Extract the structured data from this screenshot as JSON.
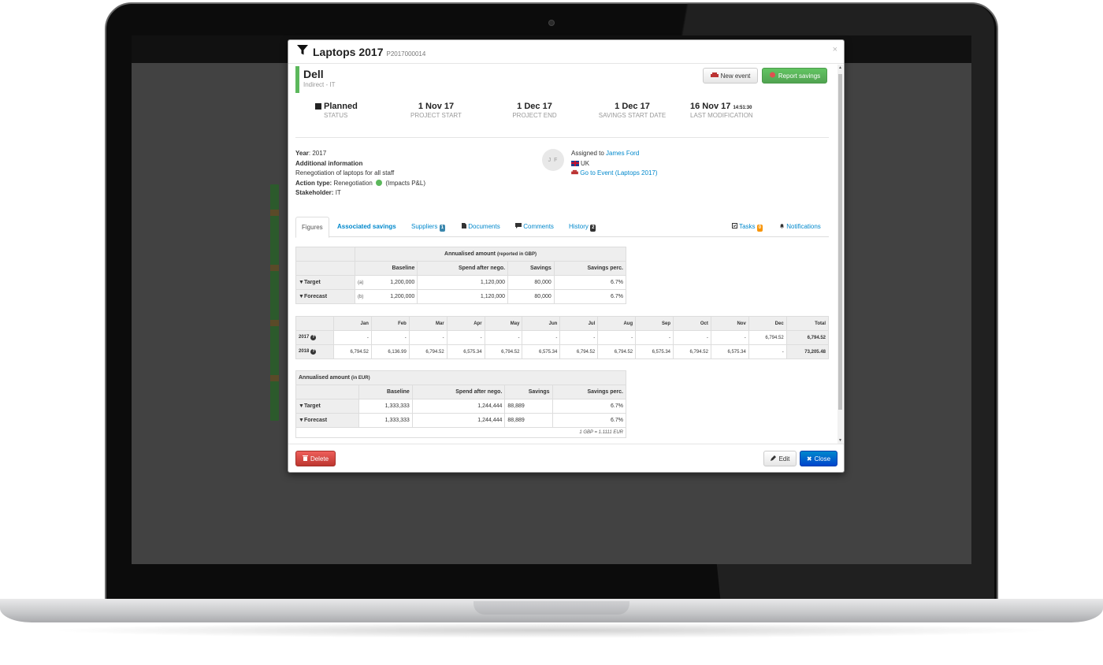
{
  "modal": {
    "title": "Laptops 2017",
    "code": "P2017000014",
    "close_x": "×",
    "supplier": {
      "name": "Dell",
      "category": "Indirect - IT"
    },
    "buttons": {
      "new_event": "New event",
      "report_savings": "Report savings",
      "delete": "Delete",
      "edit": "Edit",
      "close": "Close"
    },
    "stats": [
      {
        "value": "Planned",
        "label": "STATUS"
      },
      {
        "value": "1 Nov 17",
        "label": "PROJECT START"
      },
      {
        "value": "1 Dec 17",
        "label": "PROJECT END"
      },
      {
        "value": "1 Dec 17",
        "label": "SAVINGS START DATE"
      },
      {
        "value": "16 Nov 17",
        "time": "14:51:30",
        "label": "LAST MODIFICATION"
      }
    ],
    "info": {
      "year_label": "Year",
      "year": "2017",
      "additional_label": "Additional information",
      "additional_text": "Renegotiation of laptops for all staff",
      "action_label": "Action type:",
      "action_value": "Renegotiation",
      "action_impact": "(Impacts P&L)",
      "stakeholder_label": "Stakeholder:",
      "stakeholder_value": "IT"
    },
    "assignment": {
      "initials": "J F",
      "assigned_label": "Assigned to",
      "assigned_name": "James Ford",
      "country": "UK",
      "event_link": "Go to Event (Laptops 2017)"
    },
    "tabs": [
      {
        "label": "Figures"
      },
      {
        "label": "Associated savings"
      },
      {
        "label": "Suppliers",
        "badge": "1"
      },
      {
        "label": "Documents"
      },
      {
        "label": "Comments"
      },
      {
        "label": "History",
        "badge": "2"
      },
      {
        "label": "Tasks",
        "badge": "0"
      },
      {
        "label": "Notifications"
      }
    ],
    "gbp_table": {
      "header": "Annualised amount",
      "header_note": "(reported in GBP)",
      "columns": [
        "Baseline",
        "Spend after nego.",
        "Savings",
        "Savings perc."
      ],
      "rows": [
        {
          "label": "Target",
          "tag": "(a)",
          "values": [
            "1,200,000",
            "1,120,000",
            "80,000",
            "6.7%"
          ]
        },
        {
          "label": "Forecast",
          "tag": "(b)",
          "values": [
            "1,200,000",
            "1,120,000",
            "80,000",
            "6.7%"
          ]
        }
      ]
    },
    "monthly_table": {
      "columns": [
        "Jan",
        "Feb",
        "Mar",
        "Apr",
        "May",
        "Jun",
        "Jul",
        "Aug",
        "Sep",
        "Oct",
        "Nov",
        "Dec",
        "Total"
      ],
      "rows": [
        {
          "year": "2017",
          "values": [
            "-",
            "-",
            "-",
            "-",
            "-",
            "-",
            "-",
            "-",
            "-",
            "-",
            "-",
            "6,794.52",
            "6,794.52"
          ]
        },
        {
          "year": "2018",
          "values": [
            "6,794.52",
            "6,136.99",
            "6,794.52",
            "6,575.34",
            "6,794.52",
            "6,575.34",
            "6,794.52",
            "6,794.52",
            "6,575.34",
            "6,794.52",
            "6,575.34",
            "-",
            "73,205.48"
          ]
        }
      ]
    },
    "eur_table": {
      "header": "Annualised amount",
      "header_note": "(in EUR)",
      "columns": [
        "Baseline",
        "Spend after nego.",
        "Savings",
        "Savings perc."
      ],
      "rows": [
        {
          "label": "Target",
          "values": [
            "1,333,333",
            "1,244,444",
            "88,889",
            "6.7%"
          ]
        },
        {
          "label": "Forecast",
          "values": [
            "1,333,333",
            "1,244,444",
            "88,889",
            "6.7%"
          ]
        }
      ],
      "rate_note": "1 GBP = 1.1111 EUR"
    }
  },
  "colors": {
    "accent_green": "#5cb85c",
    "link_blue": "#0088cc",
    "danger": "#bd362f",
    "primary": "#0044cc"
  }
}
